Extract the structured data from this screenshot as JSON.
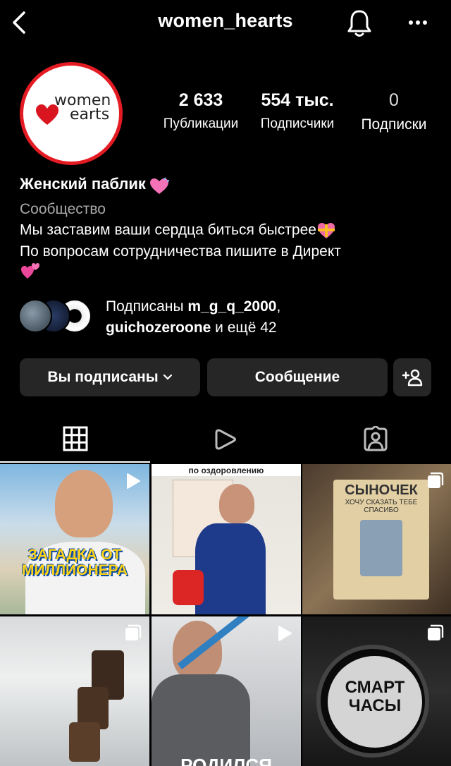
{
  "header": {
    "title": "women_hearts",
    "icons": [
      "back-chevron-icon",
      "bell-icon",
      "more-horizontal-icon"
    ]
  },
  "profile": {
    "avatar_logo_text": "women hearts",
    "stats": [
      {
        "value": "2 633",
        "label": "Публикации"
      },
      {
        "value": "554 тыс.",
        "label": "Подписчики"
      },
      {
        "value": "0",
        "label": "Подписки"
      }
    ],
    "name": "Женский паблик",
    "category": "Сообщество",
    "bio_line1": "Мы заставим ваши сердца биться быстрее",
    "bio_line2": "По вопросам сотрудничества пишите в Директ"
  },
  "followed_by": {
    "prefix": "Подписаны ",
    "user1": "m_g_q_2000",
    "separator": ",",
    "user2": "guichozeroone",
    "suffix": " и ещё 42"
  },
  "actions": {
    "subscribed_label": "Вы подписаны",
    "message_label": "Сообщение",
    "add_user_icon": "add-person-icon"
  },
  "tabs": [
    "grid-icon",
    "reels-icon",
    "tagged-icon"
  ],
  "grid": [
    {
      "overlay": "ЗАГАДКА ОТ МИЛЛИОНЕРА",
      "badge": "reel-icon"
    },
    {
      "overlay": "по оздоровлению",
      "badge": ""
    },
    {
      "overlay": "СЫНОЧЕК",
      "sub": "ХОЧУ СКАЗАТЬ ТЕБЕ СПАСИБО",
      "badge": "carousel-icon"
    },
    {
      "overlay": "",
      "badge": "carousel-icon"
    },
    {
      "overlay": "РОДИЛСЯ",
      "badge": "reel-icon"
    },
    {
      "overlay": "СМАРТ ЧАСЫ",
      "badge": "carousel-icon"
    }
  ],
  "colors": {
    "background": "#000000",
    "button_bg": "#262626",
    "secondary_text": "#a8a8a8",
    "avatar_ring": "#e41b23"
  }
}
